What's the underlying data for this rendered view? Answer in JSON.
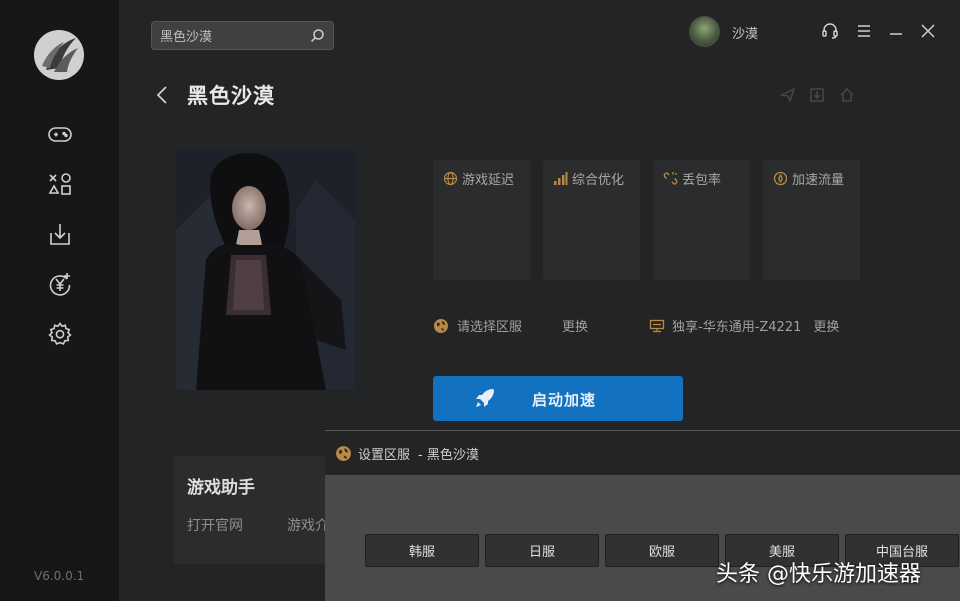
{
  "app": {
    "version": "V6.0.0.1",
    "user": {
      "name": "沙漠"
    }
  },
  "search": {
    "value": "黑色沙漠",
    "placeholder": ""
  },
  "game": {
    "title": "黑色沙漠"
  },
  "stats": [
    {
      "label": "游戏延迟",
      "icon": "globe-icon"
    },
    {
      "label": "综合优化",
      "icon": "signal-bars-icon"
    },
    {
      "label": "丢包率",
      "icon": "broken-link-icon"
    },
    {
      "label": "加速流量",
      "icon": "flow-drop-icon"
    }
  ],
  "region": {
    "label": "请选择区服",
    "change": "更换"
  },
  "node": {
    "label": "独享-华东通用-Z4221",
    "change": "更换"
  },
  "launch": {
    "label": "启动加速"
  },
  "helper": {
    "title": "游戏助手",
    "links": [
      "打开官网",
      "游戏介"
    ]
  },
  "dialog": {
    "title": "设置区服",
    "subtitle": "- 黑色沙漠",
    "regions": [
      "韩服",
      "日服",
      "欧服",
      "美服",
      "中国台服"
    ]
  },
  "watermark": "头条 @快乐游加速器",
  "colors": {
    "accent": "#1372bf",
    "icon_gold": "#b88a4a",
    "sidebar_bg": "#161718",
    "main_bg": "#232425"
  }
}
